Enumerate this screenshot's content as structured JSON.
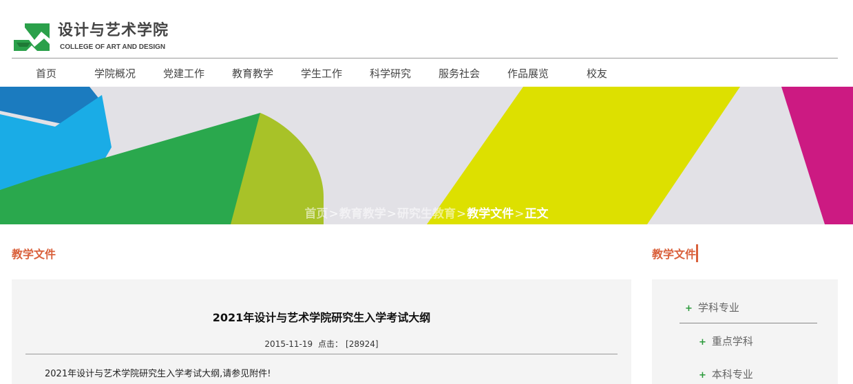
{
  "site": {
    "name_cn": "设计与艺术学院",
    "name_en": "COLLEGE OF ART AND DESIGN",
    "brand_color": "#2aa04a",
    "accent_color": "#d9603b"
  },
  "nav": [
    {
      "label": "首页"
    },
    {
      "label": "学院概况"
    },
    {
      "label": "党建工作"
    },
    {
      "label": "教育教学"
    },
    {
      "label": "学生工作"
    },
    {
      "label": "科学研究"
    },
    {
      "label": "服务社会"
    },
    {
      "label": "作品展览"
    },
    {
      "label": "校友"
    }
  ],
  "breadcrumb": [
    {
      "label": "首页"
    },
    {
      "label": "教育教学"
    },
    {
      "label": "研究生教育"
    },
    {
      "label": "教学文件"
    },
    {
      "label": "正文"
    }
  ],
  "breadcrumb_separator": ">",
  "main": {
    "section_title": "教学文件",
    "article": {
      "title": "2021年设计与艺术学院研究生入学考试大纲",
      "date": "2015-11-19",
      "clicks_label": "点击：",
      "clicks": "[28924]",
      "body": "2021年设计与艺术学院研究生入学考试大纲,请参见附件!"
    }
  },
  "sidebar": {
    "title": "教学文件",
    "items": [
      {
        "label": "学科专业",
        "icon": "plus-icon"
      },
      {
        "label": "重点学科",
        "icon": "plus-icon"
      },
      {
        "label": "本科专业",
        "icon": "plus-icon"
      }
    ]
  }
}
